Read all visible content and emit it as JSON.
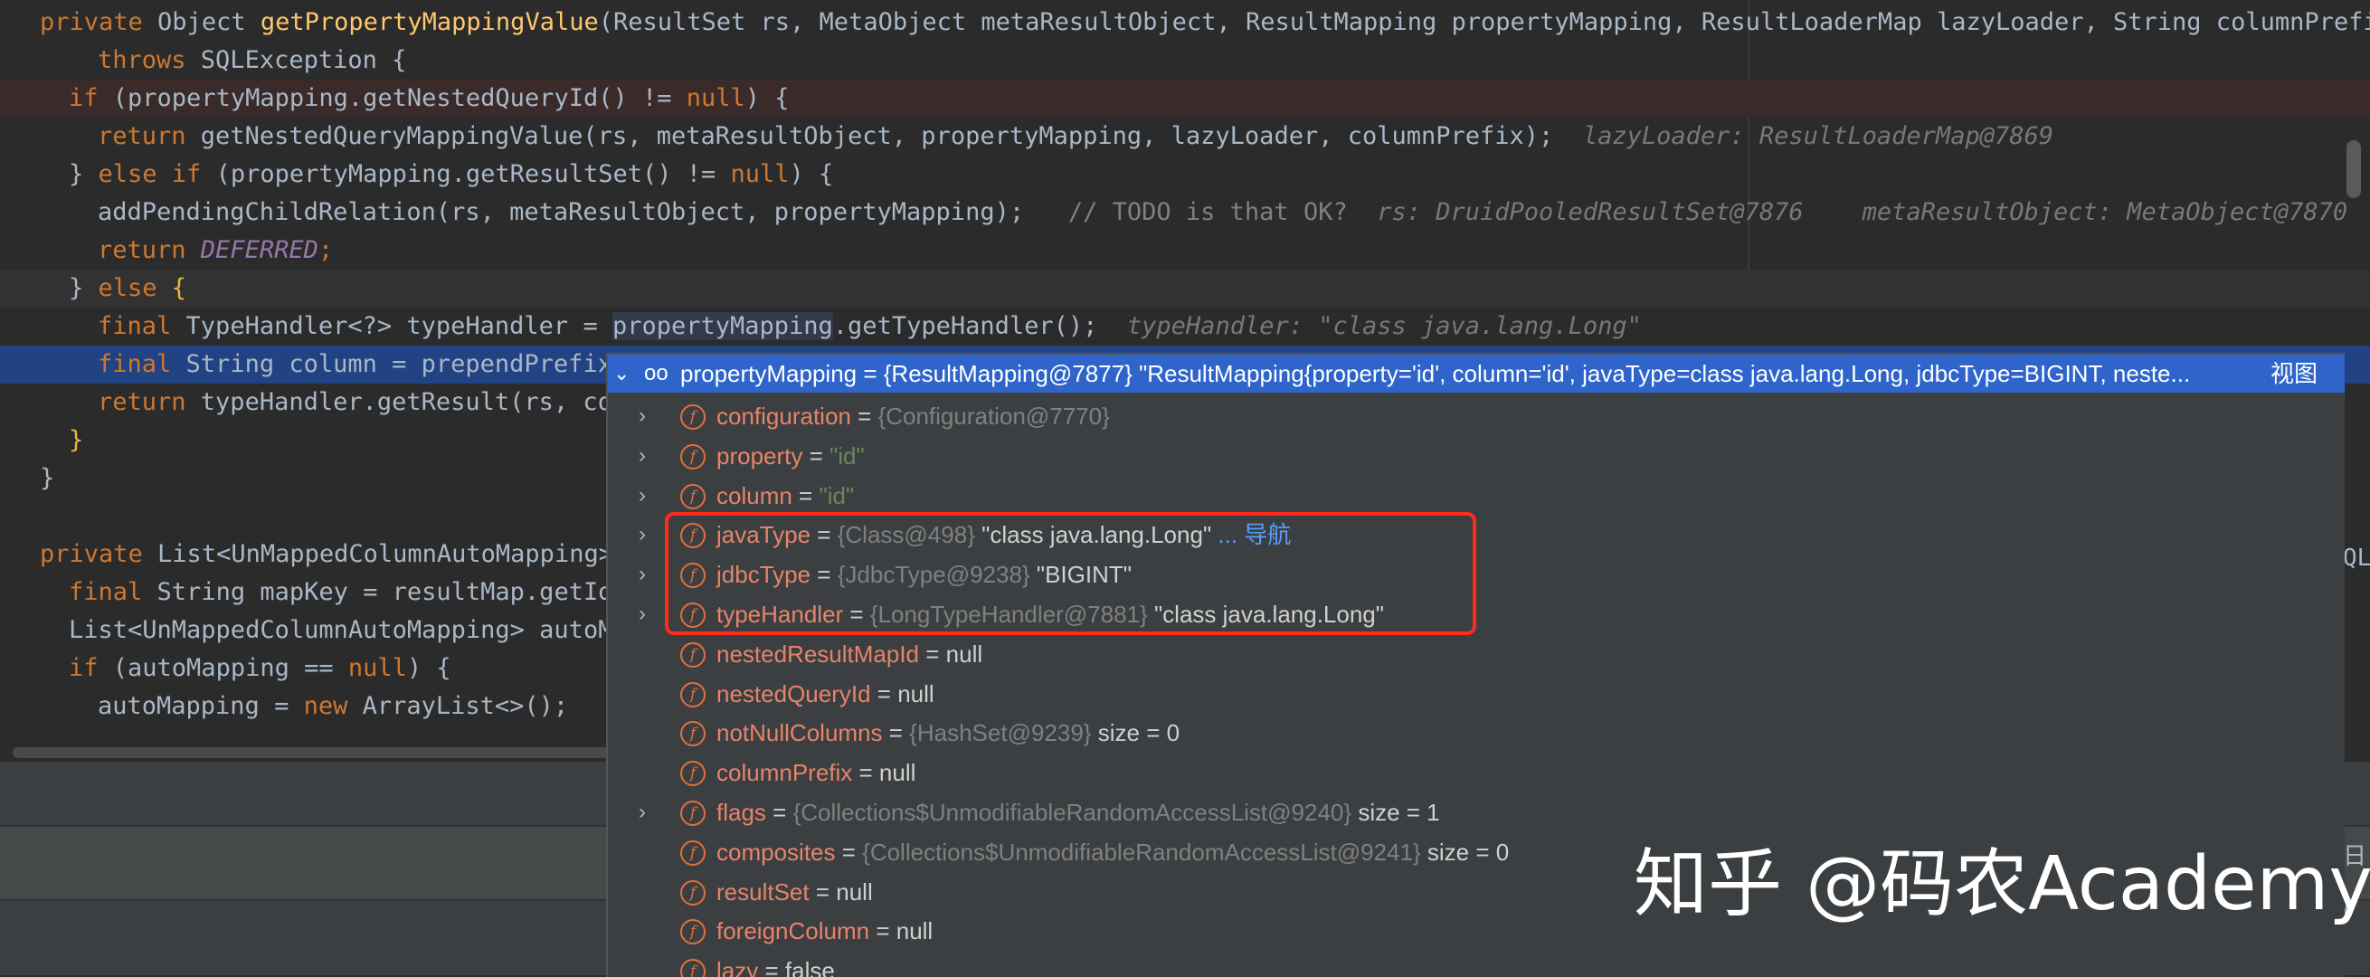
{
  "editor": {
    "lines": [
      {
        "segs": [
          [
            "kw",
            "private "
          ],
          [
            "",
            "Object "
          ],
          [
            "fn",
            "getPropertyMappingValue"
          ],
          [
            "",
            "(ResultSet rs, MetaObject metaResultObject, ResultMapping propertyMapping, ResultLoaderMap lazyLoader, String columnPrefix)"
          ]
        ]
      },
      {
        "segs": [
          [
            "kw",
            "throws "
          ],
          [
            "",
            "SQLException {"
          ]
        ]
      },
      {
        "segs": [
          [
            "kw",
            "if "
          ],
          [
            "",
            "(propertyMapping.getNestedQueryId() != "
          ],
          [
            "kw",
            "null"
          ],
          [
            "",
            ") {"
          ]
        ]
      },
      {
        "segs": [
          [
            "kw",
            "return "
          ],
          [
            "",
            "getNestedQueryMappingValue(rs, metaResultObject, propertyMapping, lazyLoader, columnPrefix);  "
          ],
          [
            "inl",
            "lazyLoader: ResultLoaderMap@7869"
          ]
        ]
      },
      {
        "segs": [
          [
            "",
            "} "
          ],
          [
            "kw",
            "else if "
          ],
          [
            "",
            "(propertyMapping.getResultSet() != "
          ],
          [
            "kw",
            "null"
          ],
          [
            "",
            ") {"
          ]
        ]
      },
      {
        "segs": [
          [
            "",
            "addPendingChildRelation(rs, metaResultObject, propertyMapping);   "
          ],
          [
            "cm",
            "// TODO is that OK?"
          ],
          [
            "",
            "  "
          ],
          [
            "inl",
            "rs: DruidPooledResultSet@7876    metaResultObject: MetaObject@7870"
          ]
        ]
      },
      {
        "segs": [
          [
            "kw",
            "return "
          ],
          [
            "it",
            "DEFERRED"
          ],
          [
            "kw",
            ";"
          ]
        ]
      },
      {
        "segs": [
          [
            "",
            "} "
          ],
          [
            "kw",
            "else "
          ],
          [
            "br",
            "{"
          ]
        ]
      },
      {
        "segs": [
          [
            "kw",
            "final "
          ],
          [
            "",
            "TypeHandler<?> typeHandler = "
          ],
          [
            "sel",
            "propertyMapping"
          ],
          [
            "",
            ".getTypeHandler();  "
          ],
          [
            "inl",
            "typeHandler: \"class java.lang.Long\""
          ]
        ]
      },
      {
        "segs": [
          [
            "kw",
            "final "
          ],
          [
            "",
            "String column = prependPrefix"
          ]
        ]
      },
      {
        "segs": [
          [
            "kw",
            "return "
          ],
          [
            "",
            "typeHandler.getResult(rs, co"
          ]
        ]
      },
      {
        "segs": [
          [
            "br",
            "}"
          ]
        ]
      },
      {
        "segs": [
          [
            "",
            "}"
          ]
        ]
      },
      {
        "segs": []
      },
      {
        "segs": [
          [
            "kw",
            "private "
          ],
          [
            "",
            "List<UnMappedColumnAutoMapping>"
          ]
        ]
      },
      {
        "segs": [
          [
            "kw",
            "final "
          ],
          [
            "",
            "String mapKey = resultMap.getId"
          ]
        ]
      },
      {
        "segs": [
          [
            "",
            "List<UnMappedColumnAutoMapping> autoM"
          ]
        ]
      },
      {
        "segs": [
          [
            "kw",
            "if "
          ],
          [
            "",
            "(autoMapping == "
          ],
          [
            "kw",
            "null"
          ],
          [
            "",
            ") {"
          ]
        ]
      },
      {
        "segs": [
          [
            "",
            "autoMapping = "
          ],
          [
            "kw",
            "new "
          ],
          [
            "",
            "ArrayList<>();"
          ]
        ]
      }
    ]
  },
  "popup": {
    "header": {
      "icon": "watch-glasses-icon",
      "text": "propertyMapping = {ResultMapping@7877} \"ResultMapping{property='id', column='id', javaType=class java.lang.Long, jdbcType=BIGINT, neste...",
      "link": "视图"
    },
    "fields": [
      {
        "expandable": true,
        "name": "configuration",
        "obj": "{Configuration@7770}",
        "value": "",
        "extra": ""
      },
      {
        "expandable": true,
        "name": "property",
        "obj": "",
        "value": "\"id\"",
        "extra": ""
      },
      {
        "expandable": true,
        "name": "column",
        "obj": "",
        "value": "\"id\"",
        "extra": ""
      },
      {
        "expandable": true,
        "name": "javaType",
        "obj": "{Class@498}",
        "value": "\"class java.lang.Long\"",
        "extra": "... 导航"
      },
      {
        "expandable": true,
        "name": "jdbcType",
        "obj": "{JdbcType@9238}",
        "value": "\"BIGINT\"",
        "extra": ""
      },
      {
        "expandable": true,
        "name": "typeHandler",
        "obj": "{LongTypeHandler@7881}",
        "value": "\"class java.lang.Long\"",
        "extra": ""
      },
      {
        "expandable": false,
        "name": "nestedResultMapId",
        "obj": "",
        "value": "null",
        "extra": ""
      },
      {
        "expandable": false,
        "name": "nestedQueryId",
        "obj": "",
        "value": "null",
        "extra": ""
      },
      {
        "expandable": false,
        "name": "notNullColumns",
        "obj": "{HashSet@9239}",
        "value": "size = 0",
        "extra": ""
      },
      {
        "expandable": false,
        "name": "columnPrefix",
        "obj": "",
        "value": "null",
        "extra": ""
      },
      {
        "expandable": true,
        "name": "flags",
        "obj": "{Collections$UnmodifiableRandomAccessList@9240}",
        "value": "size = 1",
        "extra": ""
      },
      {
        "expandable": false,
        "name": "composites",
        "obj": "{Collections$UnmodifiableRandomAccessList@9241}",
        "value": "size = 0",
        "extra": ""
      },
      {
        "expandable": false,
        "name": "resultSet",
        "obj": "",
        "value": "null",
        "extra": ""
      },
      {
        "expandable": false,
        "name": "foreignColumn",
        "obj": "",
        "value": "null",
        "extra": ""
      },
      {
        "expandable": false,
        "name": "lazy",
        "obj": "",
        "value": "false",
        "extra": ""
      }
    ]
  },
  "side_fragments": {
    "right_mid": "QL",
    "right_panel_1": "日",
    "right_panel_2": "ℓ"
  },
  "watermark": "知乎 @码农Academy",
  "colors": {
    "keyword": "#cc7832",
    "method": "#ffc66d",
    "popup_header": "#2f65ca",
    "field_name": "#e8836a",
    "highlight_box": "#ff2b1c"
  }
}
